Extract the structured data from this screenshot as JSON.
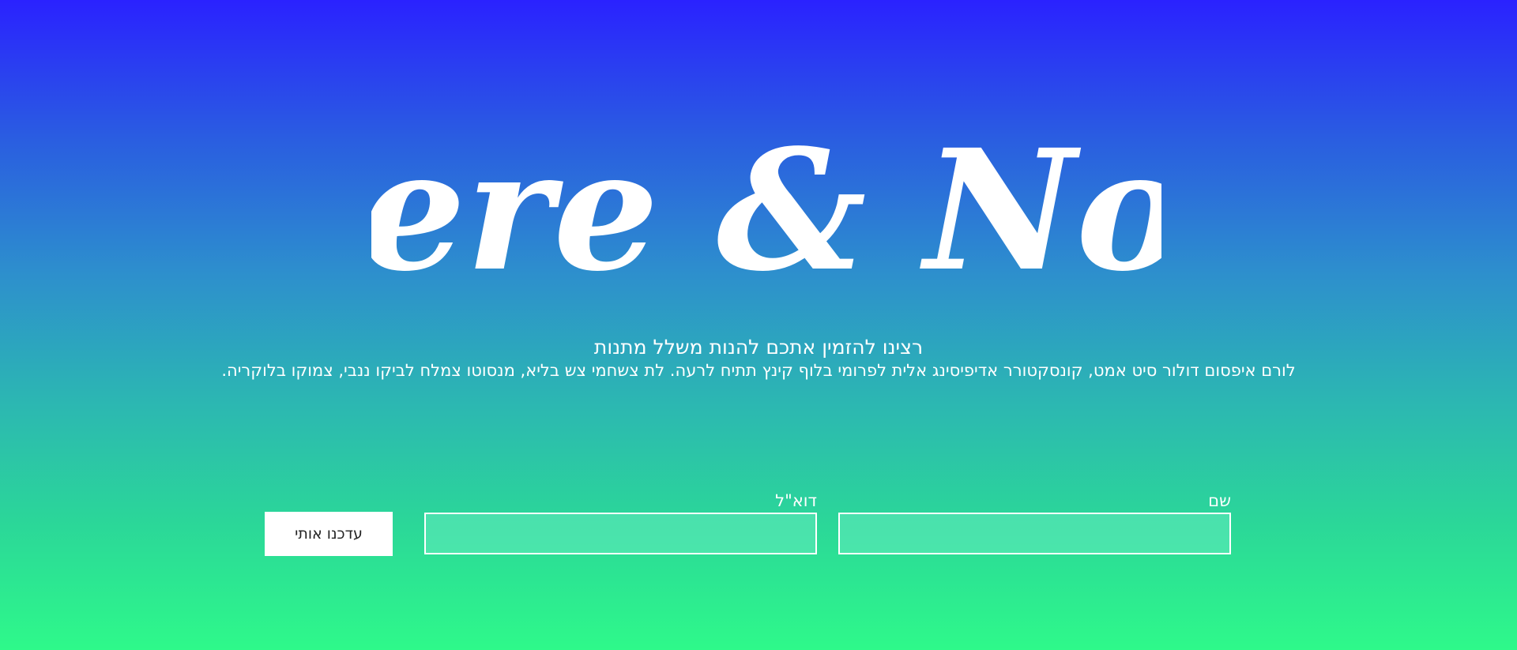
{
  "hero": {
    "logo_text": "Here & Now",
    "subtitle": "רצינו להזמין אתכם להנות משלל מתנות",
    "description": "לורם איפסום דולור סיט אמט, קונסקטורר אדיפיסינג אלית לפרומי בלוף קינץ תתיח לרעה. לת צשחמי צש בליא, מנסוטו צמלח לביקו ננבי, צמוקו בלוקריה."
  },
  "form": {
    "name_label": "שם",
    "name_value": "",
    "email_label": "דוא\"ל",
    "email_value": "",
    "submit_label": "עדכנו אותי"
  },
  "colors": {
    "gradient_top": "#2a22ff",
    "gradient_bottom": "#2ef98a",
    "text": "#ffffff",
    "input_bg": "#4adfb0",
    "button_bg": "#ffffff",
    "button_text": "#222222"
  }
}
